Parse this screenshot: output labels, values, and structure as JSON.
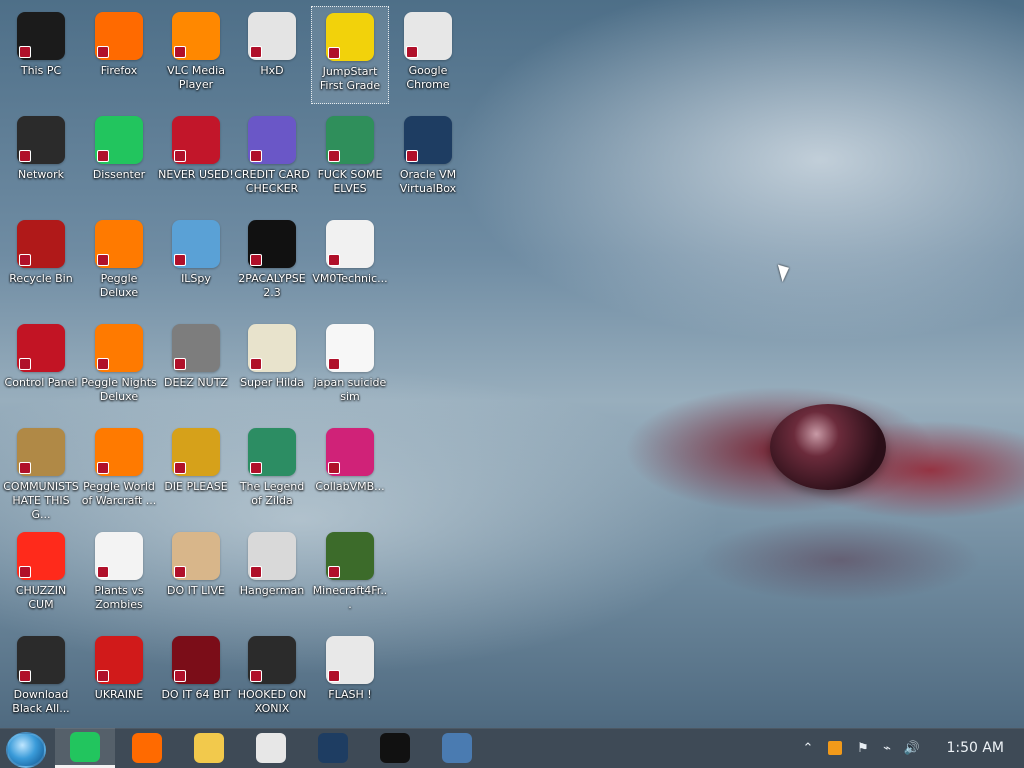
{
  "desktop": {
    "icons": [
      {
        "label": "This PC",
        "icon": "pc-icon",
        "color": "#1b1b1b"
      },
      {
        "label": "Firefox",
        "icon": "firefox-icon",
        "color": "#ff6a00"
      },
      {
        "label": "VLC Media Player",
        "icon": "vlc-icon",
        "color": "#ff8800"
      },
      {
        "label": "HxD",
        "icon": "hxd-icon",
        "color": "#e4e4e4"
      },
      {
        "label": "JumpStart First Grade",
        "icon": "jumpstart-icon",
        "color": "#f2d20b"
      },
      {
        "label": "Google Chrome",
        "icon": "chrome-icon",
        "color": "#e7e7e7"
      },
      {
        "label": "Network",
        "icon": "network-icon",
        "color": "#2b2b2b"
      },
      {
        "label": "Dissenter",
        "icon": "dissenter-icon",
        "color": "#22c55e"
      },
      {
        "label": "NEVER USED!",
        "icon": "devcpp-icon",
        "color": "#c2162a"
      },
      {
        "label": "CREDIT CARD CHECKER",
        "icon": "credit-card-icon",
        "color": "#6a57c7"
      },
      {
        "label": "FUCK SOME ELVES",
        "icon": "elf-game-icon",
        "color": "#2f8f5b"
      },
      {
        "label": "Oracle VM VirtualBox",
        "icon": "virtualbox-icon",
        "color": "#1e3d62"
      },
      {
        "label": "Recycle Bin",
        "icon": "recycle-bin-icon",
        "color": "#b01919"
      },
      {
        "label": "Peggle Deluxe",
        "icon": "peggle-icon",
        "color": "#ff7a00"
      },
      {
        "label": "ILSpy",
        "icon": "ilspy-icon",
        "color": "#5aa1d6"
      },
      {
        "label": "2PACALYPSE 2.3",
        "icon": "terminal-icon",
        "color": "#111111"
      },
      {
        "label": "VM0Technic...",
        "icon": "doctor-icon",
        "color": "#f1f1f1"
      },
      {
        "label": "Control Panel",
        "icon": "control-panel-icon",
        "color": "#c21424"
      },
      {
        "label": "Peggle Nights Deluxe",
        "icon": "peggle-nights-icon",
        "color": "#ff7a00"
      },
      {
        "label": "DEEZ NUTZ",
        "icon": "stack-icon",
        "color": "#7d7d7d"
      },
      {
        "label": "Super Hilda",
        "icon": "pixel-art-icon",
        "color": "#e8e3cc"
      },
      {
        "label": "japan suicide sim",
        "icon": "pixel-figures-icon",
        "color": "#f7f7f7"
      },
      {
        "label": "COMMUNISTS HATE THIS G...",
        "icon": "money-bag-icon",
        "color": "#b08946"
      },
      {
        "label": "Peggle World of Warcraft ...",
        "icon": "peggle-wow-icon",
        "color": "#ff7a00"
      },
      {
        "label": "DIE PLEASE",
        "icon": "de-icon",
        "color": "#d6a11a"
      },
      {
        "label": "The Legend of Zilda",
        "icon": "pixel-hero-icon",
        "color": "#2c8d63"
      },
      {
        "label": "CollabVMB...",
        "icon": "monitor-pink-icon",
        "color": "#d02278"
      },
      {
        "label": "CHUZZIN CUM",
        "icon": "chuzzle-icon",
        "color": "#ff2a1b"
      },
      {
        "label": "Plants vs Zombies",
        "icon": "pvz-icon",
        "color": "#f3f3f3"
      },
      {
        "label": "DO IT LIVE",
        "icon": "portrait-icon",
        "color": "#d8b68a"
      },
      {
        "label": "Hangerman",
        "icon": "hanger-icon",
        "color": "#d9d9d9"
      },
      {
        "label": "Minecraft4Fr...",
        "icon": "minecraft-icon",
        "color": "#3c6b2a"
      },
      {
        "label": "Download Black All...",
        "icon": "download-icon",
        "color": "#2b2b2b"
      },
      {
        "label": "UKRAINE",
        "icon": "radiation-icon",
        "color": "#d11a1a"
      },
      {
        "label": "DO IT 64 BIT",
        "icon": "cube-icon",
        "color": "#7b0d18"
      },
      {
        "label": "HOOKED ON XONIX",
        "icon": "xonix-icon",
        "color": "#2b2b2b"
      },
      {
        "label": "FLASH !",
        "icon": "flash-icon",
        "color": "#e8e8e8"
      }
    ]
  },
  "taskbar": {
    "start_label": "",
    "apps": [
      {
        "name": "dissenter-taskbar",
        "color": "#22c55e",
        "active": true
      },
      {
        "name": "firefox-taskbar",
        "color": "#ff6a00",
        "active": false
      },
      {
        "name": "file-explorer-taskbar",
        "color": "#f2c94c",
        "active": false
      },
      {
        "name": "chrome-taskbar",
        "color": "#e7e7e7",
        "active": false
      },
      {
        "name": "virtualbox-taskbar",
        "color": "#1e3d62",
        "active": false
      },
      {
        "name": "terminal-taskbar",
        "color": "#111111",
        "active": false
      },
      {
        "name": "windows10-taskbar",
        "color": "#4a7bb1",
        "active": false
      }
    ],
    "tray": {
      "up_chevron": "⌃",
      "flag": "⚑",
      "network": "⌁",
      "volume": "🔊"
    },
    "clock": "1:50 AM"
  }
}
